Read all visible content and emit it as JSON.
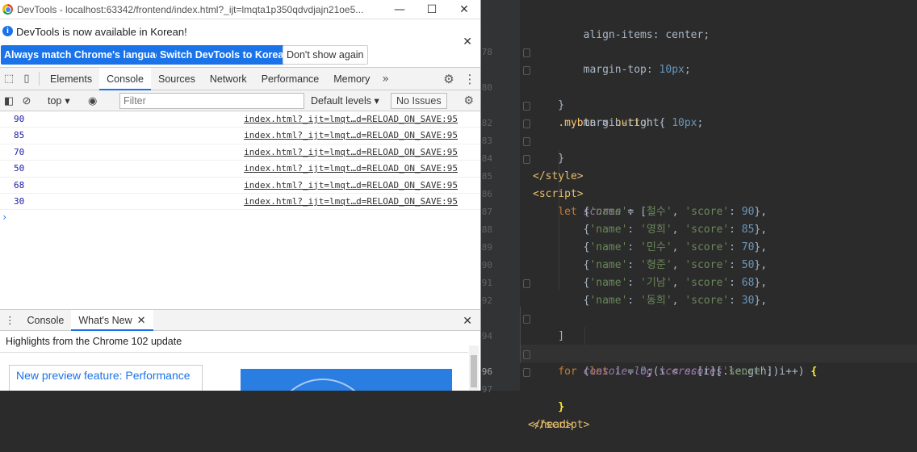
{
  "devtools": {
    "window_title": "DevTools - localhost:63342/frontend/index.html?_ijt=lmqta1p350qdvdjajn21oe5...",
    "infobar": {
      "message": "DevTools is now available in Korean!",
      "btn_match": "Always match Chrome's language",
      "btn_switch": "Switch DevTools to Korean",
      "btn_dont": "Don't show again"
    },
    "tabs": [
      "Elements",
      "Console",
      "Sources",
      "Network",
      "Performance",
      "Memory"
    ],
    "filterbar": {
      "context": "top",
      "filter_placeholder": "Filter",
      "levels": "Default levels",
      "issues": "No Issues"
    },
    "console_logs": [
      {
        "value": "90",
        "source": "index.html?_ijt=lmqt…d=RELOAD_ON_SAVE:95"
      },
      {
        "value": "85",
        "source": "index.html?_ijt=lmqt…d=RELOAD_ON_SAVE:95"
      },
      {
        "value": "70",
        "source": "index.html?_ijt=lmqt…d=RELOAD_ON_SAVE:95"
      },
      {
        "value": "50",
        "source": "index.html?_ijt=lmqt…d=RELOAD_ON_SAVE:95"
      },
      {
        "value": "68",
        "source": "index.html?_ijt=lmqt…d=RELOAD_ON_SAVE:95"
      },
      {
        "value": "30",
        "source": "index.html?_ijt=lmqt…d=RELOAD_ON_SAVE:95"
      }
    ],
    "drawer": {
      "tab_console": "Console",
      "tab_whatsnew": "What's New",
      "heading": "Highlights from the Chrome 102 update",
      "card_link": "New preview feature: Performance"
    },
    "colors": {
      "accent": "#1a73e8",
      "log_value": "#1a1aa6"
    }
  },
  "editor": {
    "line_numbers": [
      "",
      "78",
      "",
      "80",
      "",
      "82",
      "83",
      "84",
      "85",
      "86",
      "87",
      "88",
      "89",
      "90",
      "91",
      "92",
      "",
      "94",
      "",
      "96",
      "97",
      ""
    ],
    "scores": [
      {
        "name": "철수",
        "score": "90"
      },
      {
        "name": "영희",
        "score": "85"
      },
      {
        "name": "민수",
        "score": "70"
      },
      {
        "name": "형준",
        "score": "50"
      },
      {
        "name": "기남",
        "score": "68"
      },
      {
        "name": "동희",
        "score": "30"
      }
    ]
  }
}
